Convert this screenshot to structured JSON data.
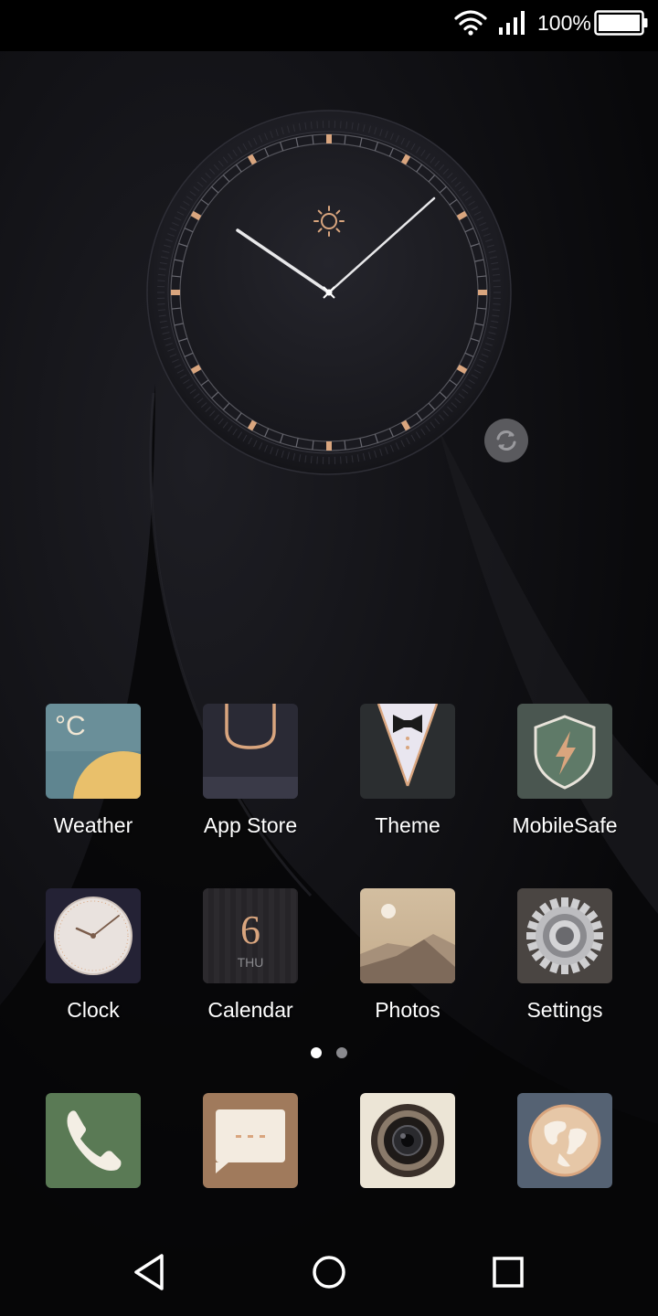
{
  "status_bar": {
    "battery_percent": "100%",
    "battery_level": 1.0,
    "wifi_icon": "wifi-icon",
    "signal_icon": "cellular-signal-icon"
  },
  "clock_widget": {
    "refresh_icon": "refresh-icon",
    "weather_icon": "sun-icon"
  },
  "apps": [
    {
      "label": "Weather",
      "icon": "weather-icon",
      "weather_unit": "°C"
    },
    {
      "label": "App Store",
      "icon": "shopping-bag-icon"
    },
    {
      "label": "Theme",
      "icon": "tuxedo-icon"
    },
    {
      "label": "MobileSafe",
      "icon": "shield-icon"
    },
    {
      "label": "Clock",
      "icon": "clock-icon"
    },
    {
      "label": "Calendar",
      "icon": "calendar-icon",
      "day_number": "6",
      "day_name": "THU"
    },
    {
      "label": "Photos",
      "icon": "landscape-icon"
    },
    {
      "label": "Settings",
      "icon": "gear-icon"
    }
  ],
  "page_indicator": {
    "pages": 2,
    "current": 1
  },
  "dock": [
    {
      "icon": "phone-icon",
      "name": "phone"
    },
    {
      "icon": "messages-icon",
      "name": "messages"
    },
    {
      "icon": "camera-icon",
      "name": "camera"
    },
    {
      "icon": "browser-globe-icon",
      "name": "browser"
    }
  ],
  "nav_bar": {
    "back_icon": "back-triangle-icon",
    "home_icon": "home-circle-icon",
    "recents_icon": "recents-square-icon"
  },
  "colors": {
    "accent_gold": "#d9a57e",
    "status_bar_bg": "#000000",
    "weather_bg": "#5f8590",
    "weather_sun": "#e9c06b",
    "phone_bg": "#5a7a55",
    "messages_bg": "#a07a5c",
    "browser_bg": "#556273"
  }
}
